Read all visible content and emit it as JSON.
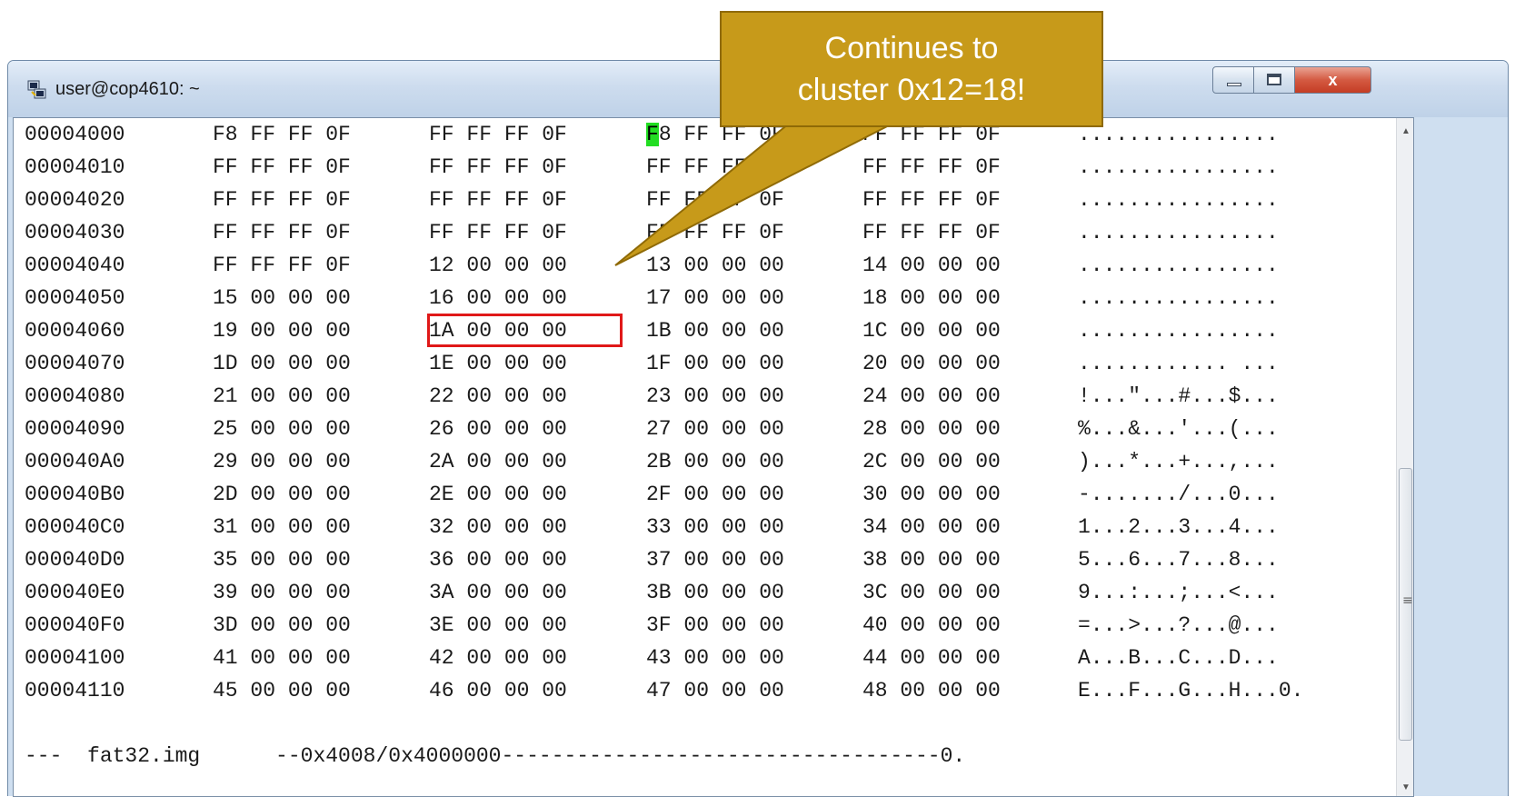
{
  "window": {
    "title": "user@cop4610: ~",
    "controls": {
      "minimize": "minimize",
      "maximize": "maximize",
      "close": "x"
    }
  },
  "hex_view": {
    "rows": [
      {
        "addr": "00004000",
        "groups": [
          "F8 FF FF 0F",
          "FF FF FF 0F",
          "F8 FF FF 0F",
          "FF FF FF 0F"
        ],
        "ascii": "................"
      },
      {
        "addr": "00004010",
        "groups": [
          "FF FF FF 0F",
          "FF FF FF 0F",
          "FF FF FF 0F",
          "FF FF FF 0F"
        ],
        "ascii": "................"
      },
      {
        "addr": "00004020",
        "groups": [
          "FF FF FF 0F",
          "FF FF FF 0F",
          "FF FF FF 0F",
          "FF FF FF 0F"
        ],
        "ascii": "................"
      },
      {
        "addr": "00004030",
        "groups": [
          "FF FF FF 0F",
          "FF FF FF 0F",
          "FF FF FF 0F",
          "FF FF FF 0F"
        ],
        "ascii": "................"
      },
      {
        "addr": "00004040",
        "groups": [
          "FF FF FF 0F",
          "12 00 00 00",
          "13 00 00 00",
          "14 00 00 00"
        ],
        "ascii": "................"
      },
      {
        "addr": "00004050",
        "groups": [
          "15 00 00 00",
          "16 00 00 00",
          "17 00 00 00",
          "18 00 00 00"
        ],
        "ascii": "................"
      },
      {
        "addr": "00004060",
        "groups": [
          "19 00 00 00",
          "1A 00 00 00",
          "1B 00 00 00",
          "1C 00 00 00"
        ],
        "ascii": "................"
      },
      {
        "addr": "00004070",
        "groups": [
          "1D 00 00 00",
          "1E 00 00 00",
          "1F 00 00 00",
          "20 00 00 00"
        ],
        "ascii": "............ ..."
      },
      {
        "addr": "00004080",
        "groups": [
          "21 00 00 00",
          "22 00 00 00",
          "23 00 00 00",
          "24 00 00 00"
        ],
        "ascii": "!...\"...#...$..."
      },
      {
        "addr": "00004090",
        "groups": [
          "25 00 00 00",
          "26 00 00 00",
          "27 00 00 00",
          "28 00 00 00"
        ],
        "ascii": "%...&...'...(..."
      },
      {
        "addr": "000040A0",
        "groups": [
          "29 00 00 00",
          "2A 00 00 00",
          "2B 00 00 00",
          "2C 00 00 00"
        ],
        "ascii": ")...*...+...,..."
      },
      {
        "addr": "000040B0",
        "groups": [
          "2D 00 00 00",
          "2E 00 00 00",
          "2F 00 00 00",
          "30 00 00 00"
        ],
        "ascii": "-......./...0..."
      },
      {
        "addr": "000040C0",
        "groups": [
          "31 00 00 00",
          "32 00 00 00",
          "33 00 00 00",
          "34 00 00 00"
        ],
        "ascii": "1...2...3...4..."
      },
      {
        "addr": "000040D0",
        "groups": [
          "35 00 00 00",
          "36 00 00 00",
          "37 00 00 00",
          "38 00 00 00"
        ],
        "ascii": "5...6...7...8..."
      },
      {
        "addr": "000040E0",
        "groups": [
          "39 00 00 00",
          "3A 00 00 00",
          "3B 00 00 00",
          "3C 00 00 00"
        ],
        "ascii": "9...:...;...<..."
      },
      {
        "addr": "000040F0",
        "groups": [
          "3D 00 00 00",
          "3E 00 00 00",
          "3F 00 00 00",
          "40 00 00 00"
        ],
        "ascii": "=...>...?...@..."
      },
      {
        "addr": "00004100",
        "groups": [
          "41 00 00 00",
          "42 00 00 00",
          "43 00 00 00",
          "44 00 00 00"
        ],
        "ascii": "A...B...C...D..."
      },
      {
        "addr": "00004110",
        "groups": [
          "45 00 00 00",
          "46 00 00 00",
          "47 00 00 00",
          "48 00 00 00"
        ],
        "ascii": "E...F...G...H...0."
      }
    ],
    "cursor_char": "F",
    "status_line": "---  fat32.img      --0x4008/0x4000000-----------------------------------0."
  },
  "callout": {
    "line1": "Continues to",
    "line2": "cluster 0x12=18!"
  },
  "colors": {
    "callout_fill": "#c79a1a",
    "highlight_border": "#e01818",
    "cursor_highlight": "#22dd22",
    "close_button": "#c43d24"
  },
  "icons": {
    "app": "putty-icon",
    "minimize": "minimize-icon",
    "maximize": "maximize-icon",
    "close": "close-icon"
  }
}
